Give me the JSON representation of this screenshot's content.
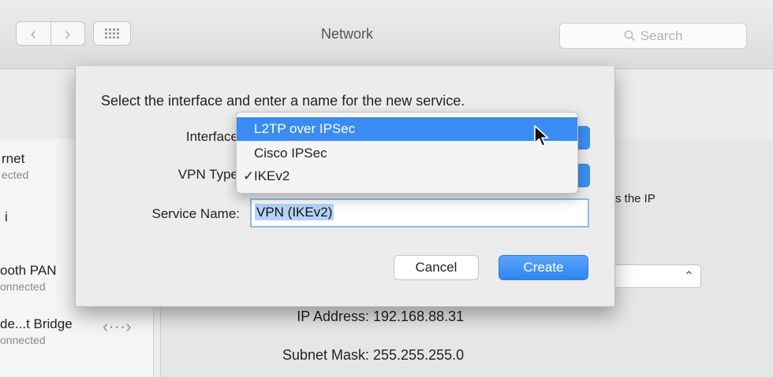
{
  "window": {
    "title": "Network"
  },
  "toolbar": {
    "back_icon": "chevron-left-icon",
    "forward_icon": "chevron-right-icon",
    "grid_icon": "show-all-grid-icon",
    "search_placeholder": "Search"
  },
  "sidebar": {
    "services": [
      {
        "name": "rnet",
        "status": "ected"
      },
      {
        "name": "i",
        "status": ""
      },
      {
        "name": "ooth PAN",
        "status": "onnected"
      },
      {
        "name": "de...t Bridge",
        "status": "onnected"
      }
    ]
  },
  "detail": {
    "partial_text": "s the IP",
    "ip_label": "IP Address:",
    "ip_value": "192.168.88.31",
    "subnet_label": "Subnet Mask:",
    "subnet_value": "255.255.255.0"
  },
  "sheet": {
    "prompt": "Select the interface and enter a name for the new service.",
    "interface_label": "Interface",
    "vpn_type_label": "VPN Type",
    "service_name_label": "Service Name:",
    "service_name_value": "VPN (IKEv2)",
    "cancel_label": "Cancel",
    "create_label": "Create"
  },
  "menu": {
    "items": [
      {
        "label": "L2TP over IPSec",
        "highlighted": true,
        "checked": false
      },
      {
        "label": "Cisco IPSec",
        "highlighted": false,
        "checked": false
      },
      {
        "label": "IKEv2",
        "highlighted": false,
        "checked": true
      }
    ],
    "check_glyph": "✓"
  },
  "colors": {
    "accent": "#3b8cf2",
    "selection": "#b5d3f7"
  }
}
